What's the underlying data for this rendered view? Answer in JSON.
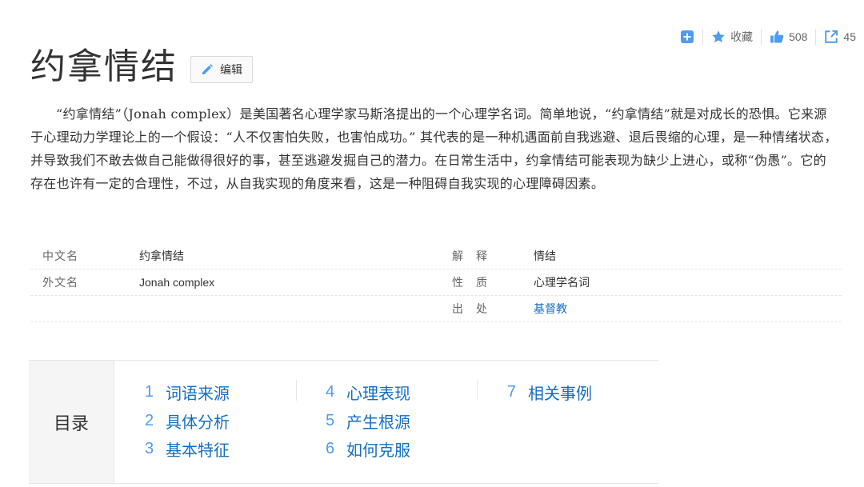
{
  "toolbar": {
    "favorite_label": "收藏",
    "like_count": "508",
    "share_count": "45",
    "accent_color": "#4f9cee"
  },
  "title": "约拿情结",
  "edit_label": "编辑",
  "summary": "“约拿情结”（Jonah complex）是美国著名心理学家马斯洛提出的一个心理学名词。简单地说，“约拿情结”就是对成长的恐惧。它来源于心理动力学理论上的一个假设：“人不仅害怕失败，也害怕成功。” 其代表的是一种机遇面前自我逃避、退后畏缩的心理，是一种情绪状态，并导致我们不敢去做自己能做得很好的事，甚至逃避发掘自己的潜力。在日常生活中，约拿情结可能表现为缺少上进心，或称“伪愚”。它的存在也许有一定的合理性，不过，从自我实现的角度来看，这是一种阻碍自我实现的心理障碍因素。",
  "info": {
    "rows": [
      {
        "l_label": "中文名",
        "l_value": "约拿情结",
        "r_label": "解释",
        "r_value": "情结"
      },
      {
        "l_label": "外文名",
        "l_value": "Jonah complex",
        "r_label": "性质",
        "r_value": "心理学名词"
      },
      {
        "l_label": "",
        "l_value": "",
        "r_label": "出处",
        "r_value": "基督教"
      }
    ]
  },
  "catalog": {
    "heading": "目录",
    "items": [
      {
        "num": "1",
        "text": "词语来源"
      },
      {
        "num": "2",
        "text": "具体分析"
      },
      {
        "num": "3",
        "text": "基本特征"
      },
      {
        "num": "4",
        "text": "心理表现"
      },
      {
        "num": "5",
        "text": "产生根源"
      },
      {
        "num": "6",
        "text": "如何克服"
      },
      {
        "num": "7",
        "text": "相关事例"
      }
    ]
  }
}
